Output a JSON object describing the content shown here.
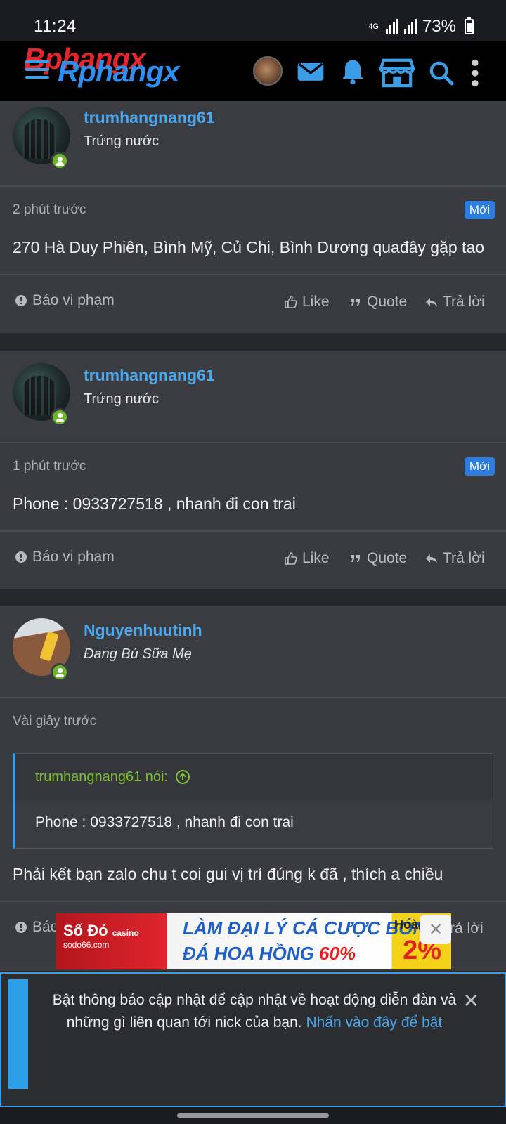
{
  "status": {
    "time": "11:24",
    "network": "4G",
    "battery": "73%"
  },
  "header": {
    "logo": "Bphangx",
    "logo_sub": "Rphangx"
  },
  "posts": [
    {
      "username": "trumhangnang61",
      "user_title": "Trứng nước",
      "ago": "2 phút trước",
      "badge": "Mới",
      "text": "270 Hà Duy Phiên, Bình Mỹ, Củ Chi, Bình Dương quađây gặp tao"
    },
    {
      "username": "trumhangnang61",
      "user_title": "Trứng nước",
      "ago": "1 phút trước",
      "badge": "Mới",
      "text": "Phone : 0933727518 , nhanh đi con trai"
    },
    {
      "username": "Nguyenhuutinh",
      "user_title": "Đang Bú Sữa Mẹ",
      "ago": "Vài giây trước",
      "quote_author": "trumhangnang61 nói:",
      "quote_text": "Phone : 0933727518 , nhanh đi con trai",
      "text": "Phải kết bạn zalo chu t coi gui vị trí đúng k đã , thích a chiều"
    }
  ],
  "actions": {
    "report": "Báo vi phạm",
    "report_truncated": "Báo",
    "like": "Like",
    "quote": "Quote",
    "reply": "Trả lời"
  },
  "ad": {
    "brand": "Số Đỏ",
    "brand_tag": "casino",
    "brand_url": "sodo66.com",
    "line1": "LÀM ĐẠI LÝ CÁ CƯỢC BÓNG",
    "line2": "ĐÁ HOA HỒNG",
    "line2_pct": "60%",
    "refund_label": "Hoàn trả",
    "refund_pct": "2%"
  },
  "notification": {
    "message": "Bật thông báo cập nhật để cập nhật về hoạt động diễn đàn và những gì liên quan tới nick của bạn.",
    "link": "Nhấn vào đây để bật"
  },
  "colors": {
    "accent": "#3a9de6",
    "username": "#4aa9ee",
    "online": "#6bb52a",
    "badge": "#2d7de0"
  }
}
